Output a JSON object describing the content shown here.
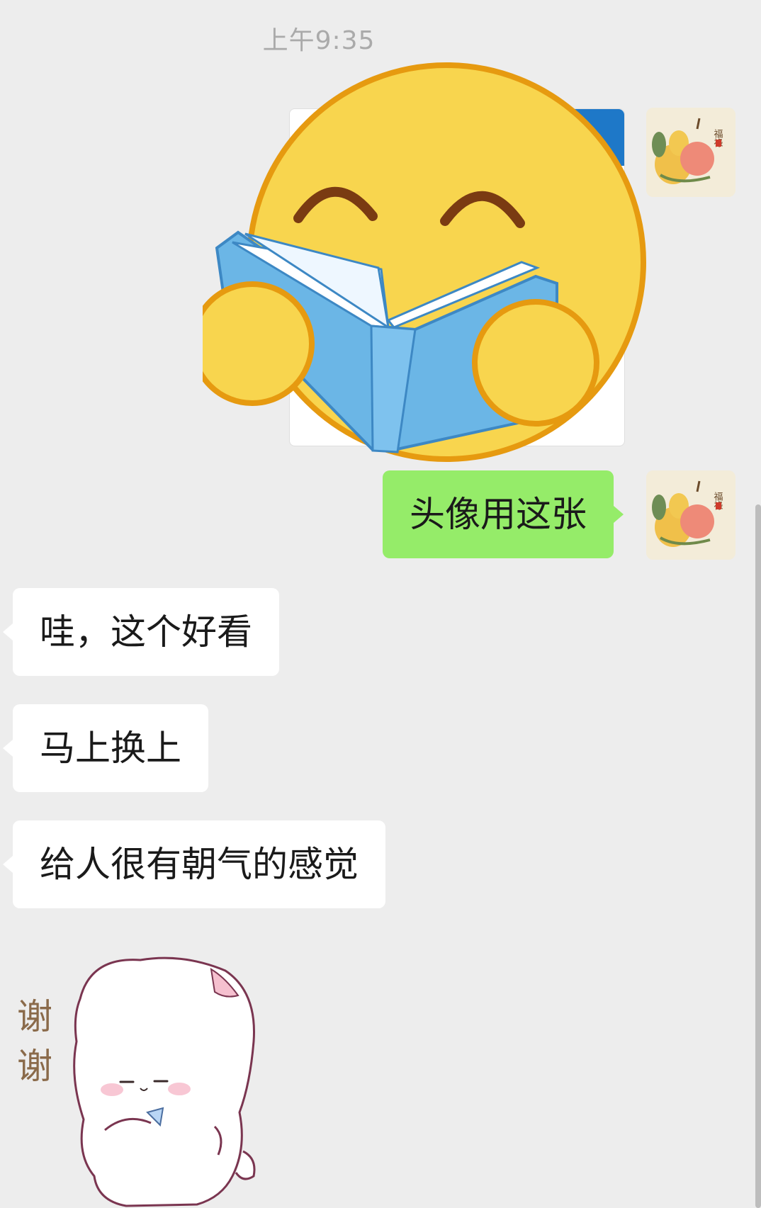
{
  "timestamp": "上午9:35",
  "messages": {
    "sent_text": "头像用这张",
    "received": [
      "哇，这个好看",
      "马上换上",
      "给人很有朝气的感觉"
    ]
  },
  "stickers": {
    "sent": "reading-book-emoji",
    "received": "cat-thanks-sticker",
    "received_caption_1": "谢",
    "received_caption_2": "谢"
  },
  "avatar": {
    "seal_text": "福祿"
  },
  "colors": {
    "background": "#ededed",
    "sent_bubble": "#95ec69",
    "received_bubble": "#ffffff",
    "emoji_face": "#f8d54e",
    "emoji_outline": "#e69a10",
    "book_blue": "#6bb6e6"
  }
}
